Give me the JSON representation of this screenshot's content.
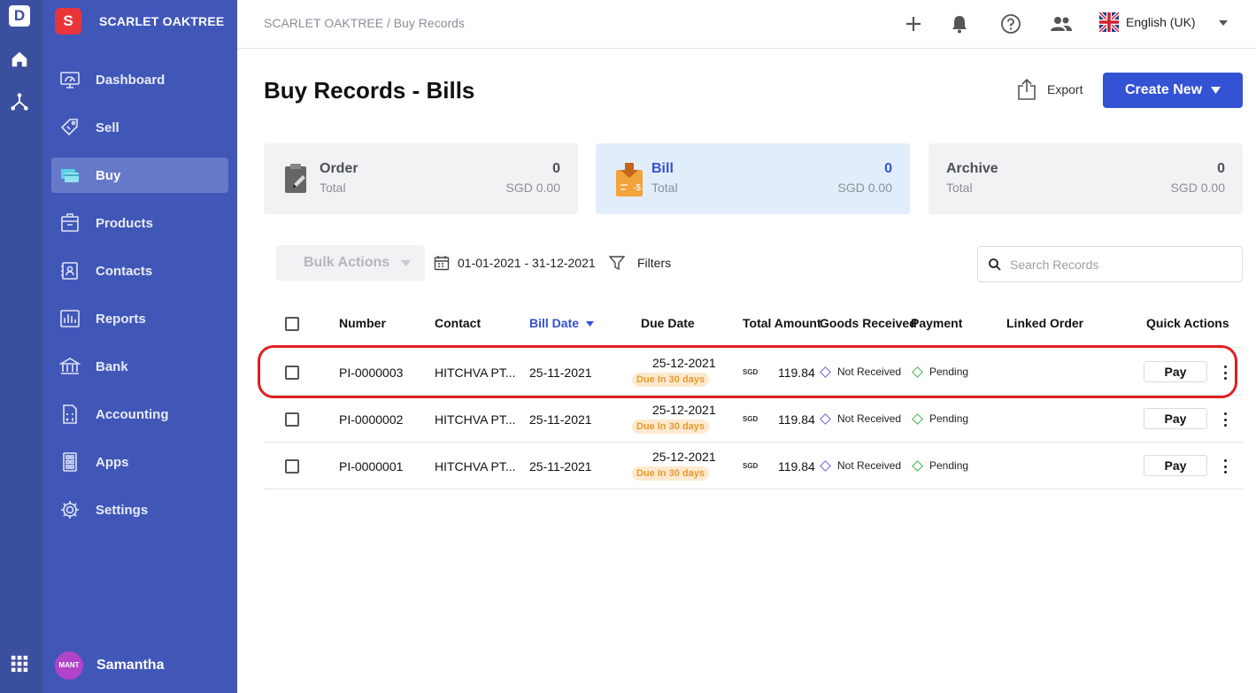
{
  "app_logo": "D",
  "org": {
    "badge": "S",
    "name": "SCARLET OAKTREE"
  },
  "sidebar": {
    "items": [
      {
        "label": "Dashboard",
        "icon": "dashboard-icon"
      },
      {
        "label": "Sell",
        "icon": "sell-icon"
      },
      {
        "label": "Buy",
        "icon": "buy-icon",
        "active": true
      },
      {
        "label": "Products",
        "icon": "products-icon"
      },
      {
        "label": "Contacts",
        "icon": "contacts-icon"
      },
      {
        "label": "Reports",
        "icon": "reports-icon"
      },
      {
        "label": "Bank",
        "icon": "bank-icon"
      },
      {
        "label": "Accounting",
        "icon": "accounting-icon"
      },
      {
        "label": "Apps",
        "icon": "apps-icon"
      },
      {
        "label": "Settings",
        "icon": "gear-icon"
      }
    ]
  },
  "user": {
    "avatar_text": "MANT",
    "name": "Samantha"
  },
  "header": {
    "breadcrumb": "SCARLET OAKTREE / Buy Records",
    "language": "English (UK)"
  },
  "page": {
    "title": "Buy Records - Bills",
    "export_label": "Export",
    "create_label": "Create New"
  },
  "cards": [
    {
      "title": "Order",
      "subtitle": "Total",
      "count": "0",
      "amount": "SGD 0.00"
    },
    {
      "title": "Bill",
      "subtitle": "Total",
      "count": "0",
      "amount": "SGD 0.00",
      "active": true
    },
    {
      "title": "Archive",
      "subtitle": "Total",
      "count": "0",
      "amount": "SGD 0.00"
    }
  ],
  "toolbar": {
    "bulk_label": "Bulk Actions",
    "date_range": "01-01-2021 - 31-12-2021",
    "filters_label": "Filters",
    "search_placeholder": "Search Records"
  },
  "table": {
    "columns": [
      "Number",
      "Contact",
      "Bill Date",
      "Due Date",
      "Total Amount",
      "Goods Received",
      "Payment",
      "Linked Order",
      "Quick Actions"
    ],
    "rows": [
      {
        "number": "PI-0000003",
        "contact": "HITCHVA PT...",
        "bill_date": "25-11-2021",
        "due_date": "25-12-2021",
        "due_badge": "Due In 30 days",
        "currency": "SGD",
        "amount": "119.84",
        "goods": "Not Received",
        "payment": "Pending",
        "action": "Pay"
      },
      {
        "number": "PI-0000002",
        "contact": "HITCHVA PT...",
        "bill_date": "25-11-2021",
        "due_date": "25-12-2021",
        "due_badge": "Due In 30 days",
        "currency": "SGD",
        "amount": "119.84",
        "goods": "Not Received",
        "payment": "Pending",
        "action": "Pay"
      },
      {
        "number": "PI-0000001",
        "contact": "HITCHVA PT...",
        "bill_date": "25-11-2021",
        "due_date": "25-12-2021",
        "due_badge": "Due In 30 days",
        "currency": "SGD",
        "amount": "119.84",
        "goods": "Not Received",
        "payment": "Pending",
        "action": "Pay"
      }
    ]
  },
  "colors": {
    "sidebar": "#4157b8",
    "rail": "#3a4f9e",
    "accent": "#3452d4",
    "highlight": "#e02020",
    "not_received": "#6b63d8",
    "pending": "#3bb54a",
    "due_badge": "#e89a2c"
  }
}
